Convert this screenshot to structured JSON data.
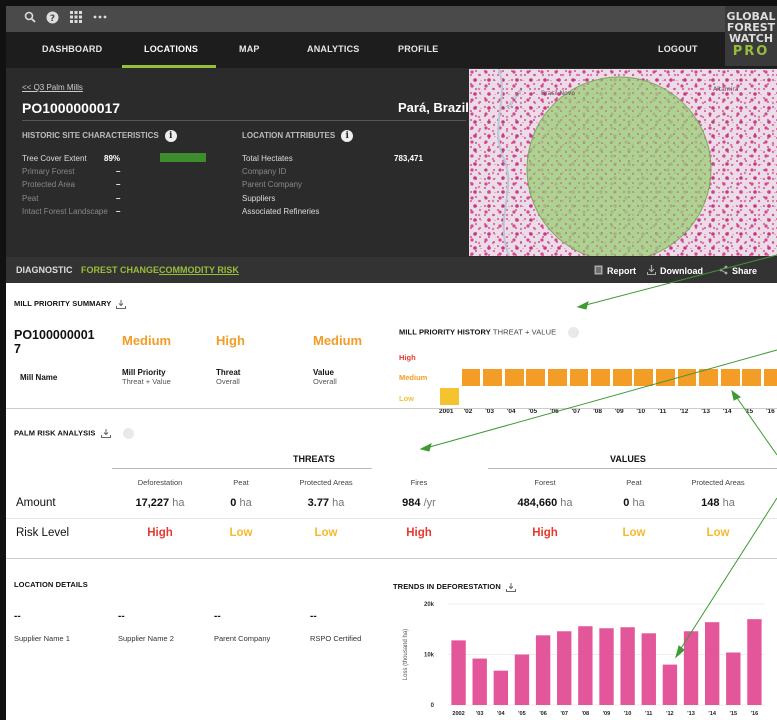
{
  "topbar": {
    "icons": [
      "search-icon",
      "help-icon",
      "grid-icon",
      "more-icon"
    ]
  },
  "logo": {
    "line1": "GLOBAL",
    "line2": "FOREST",
    "line3": "WATCH",
    "pro": "PRO"
  },
  "nav": {
    "items": [
      "DASHBOARD",
      "LOCATIONS",
      "MAP",
      "ANALYTICS",
      "PROFILE"
    ],
    "active": "LOCATIONS",
    "logout": "LOGOUT"
  },
  "header": {
    "back_link": "<< Q3 Palm Mills",
    "site_id": "PO1000000017",
    "location": "Pará, Brazil",
    "historic_title": "HISTORIC SITE CHARACTERISTICS",
    "historic": [
      {
        "label": "Tree Cover Extent",
        "value": "89%"
      },
      {
        "label": "Primary Forest",
        "value": "–"
      },
      {
        "label": "Protected Area",
        "value": "–"
      },
      {
        "label": "Peat",
        "value": "–"
      },
      {
        "label": "Intact Forest Landscape",
        "value": "–"
      }
    ],
    "tree_cover_pct": 89,
    "attributes_title": "LOCATION ATTRIBUTES",
    "attributes": [
      {
        "label": "Total Hectates",
        "value": "783,471"
      },
      {
        "label": "Company ID",
        "value": ""
      },
      {
        "label": "Parent Company",
        "value": ""
      },
      {
        "label": "Suppliers",
        "value": ""
      },
      {
        "label": "Associated Refineries",
        "value": ""
      }
    ]
  },
  "map": {
    "labels": [
      "Brasil Novo",
      "Altamira",
      "Rio Xingu"
    ]
  },
  "tabs": {
    "diagnostic": "DIAGNOSTIC",
    "forest_change": "FOREST CHANGE",
    "commodity_risk": "COMMODITY RISK",
    "report": "Report",
    "download": "Download",
    "share": "Share"
  },
  "summary": {
    "title": "MILL PRIORITY SUMMARY",
    "id": "PO100000001 7",
    "id_line1": "PO100000001",
    "id_line2": "7",
    "priority": "Medium",
    "threat": "High",
    "value": "Medium",
    "mill_name_label": "Mill Name",
    "priority_label": "Mill Priority",
    "priority_sub": "Threat + Value",
    "threat_label": "Threat",
    "threat_sub": "Overall",
    "value_label": "Value",
    "value_sub": "Overall"
  },
  "history": {
    "title": "MILL PRIORITY HISTORY",
    "subtitle": "THREAT + VALUE",
    "levels": [
      "High",
      "Medium",
      "Low"
    ],
    "years": [
      "2001",
      "'02",
      "'03",
      "'04",
      "'05",
      "'06",
      "'07",
      "'08",
      "'09",
      "'10",
      "'11",
      "'12",
      "'13",
      "'14",
      "'15",
      "'16"
    ],
    "values": [
      "Low",
      "Medium",
      "Medium",
      "Medium",
      "Medium",
      "Medium",
      "Medium",
      "Medium",
      "Medium",
      "Medium",
      "Medium",
      "Medium",
      "Medium",
      "Medium",
      "Medium",
      "Medium"
    ],
    "colors": {
      "medium": "#f39c26",
      "low": "#f5c330",
      "high": "#e8392f"
    }
  },
  "risk": {
    "title": "PALM RISK ANALYSIS",
    "threats_title": "THREATS",
    "values_title": "VALUES",
    "columns": [
      "Deforestation",
      "Peat",
      "Protected Areas",
      "Fires",
      "Forest",
      "Peat",
      "Protected Areas"
    ],
    "amount_label": "Amount",
    "risk_label": "Risk Level",
    "amounts": [
      {
        "num": "17,227",
        "unit": "ha"
      },
      {
        "num": "0",
        "unit": "ha"
      },
      {
        "num": "3.77",
        "unit": "ha"
      },
      {
        "num": "984",
        "unit": "/yr"
      },
      {
        "num": "484,660",
        "unit": "ha"
      },
      {
        "num": "0",
        "unit": "ha"
      },
      {
        "num": "148",
        "unit": "ha"
      }
    ],
    "levels": [
      "High",
      "Low",
      "Low",
      "High",
      "High",
      "Low",
      "Low"
    ]
  },
  "location_details": {
    "title": "LOCATION DETAILS",
    "items": [
      {
        "value": "--",
        "label": "Supplier Name 1"
      },
      {
        "value": "--",
        "label": "Supplier Name 2"
      },
      {
        "value": "--",
        "label": "Parent Company"
      },
      {
        "value": "--",
        "label": "RSPO Certified"
      }
    ]
  },
  "chart_data": {
    "type": "bar",
    "title": "TRENDS IN DEFORESTATION",
    "ylabel": "Loss (thousand ha)",
    "categories": [
      "2002",
      "'03",
      "'04",
      "'05",
      "'06",
      "'07",
      "'08",
      "'09",
      "'10",
      "'11",
      "'12",
      "'13",
      "'14",
      "'15",
      "'16"
    ],
    "values": [
      12.8,
      9.2,
      6.8,
      10.0,
      13.8,
      14.6,
      15.6,
      15.2,
      15.4,
      14.2,
      8.0,
      14.6,
      16.4,
      10.4,
      17.0
    ],
    "ylim": [
      0,
      20
    ],
    "yticks": [
      "0",
      "10k",
      "20k"
    ],
    "color": "#e3579a"
  }
}
